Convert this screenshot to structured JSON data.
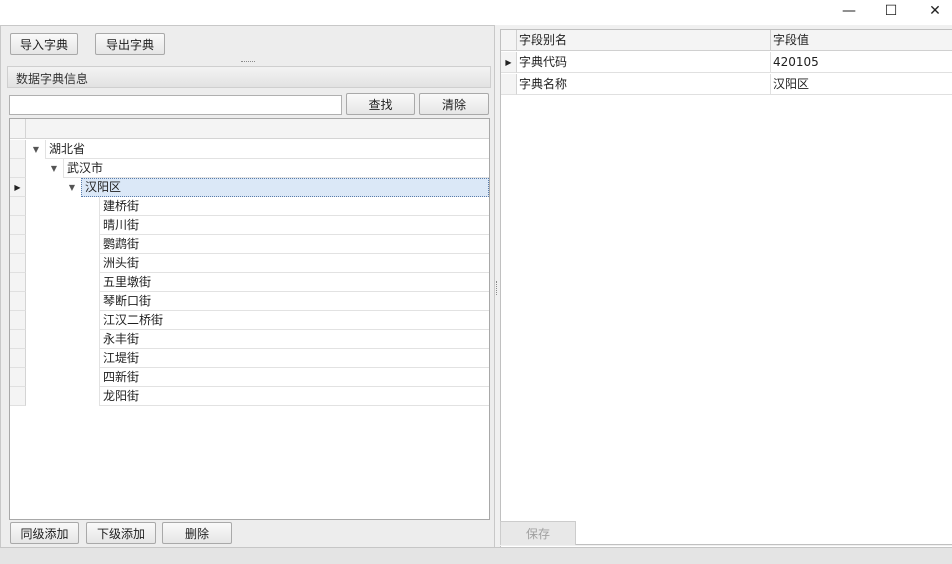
{
  "window": {
    "controls": {
      "minimize": "—",
      "maximize": "☐",
      "close": "✕"
    }
  },
  "toolbar": {
    "import_label": "导入字典",
    "export_label": "导出字典"
  },
  "dictionary_panel": {
    "title": "数据字典信息",
    "search": {
      "value": "",
      "placeholder": ""
    },
    "find_label": "查找",
    "clear_label": "清除"
  },
  "tree": {
    "rows": [
      {
        "label": "湖北省",
        "level": 0,
        "expanded": true,
        "selected": false
      },
      {
        "label": "武汉市",
        "level": 1,
        "expanded": true,
        "selected": false
      },
      {
        "label": "汉阳区",
        "level": 2,
        "expanded": true,
        "selected": true
      },
      {
        "label": "建桥街",
        "level": 3,
        "expanded": false,
        "selected": false
      },
      {
        "label": "晴川街",
        "level": 3,
        "expanded": false,
        "selected": false
      },
      {
        "label": "鹦鹉街",
        "level": 3,
        "expanded": false,
        "selected": false
      },
      {
        "label": "洲头街",
        "level": 3,
        "expanded": false,
        "selected": false
      },
      {
        "label": "五里墩街",
        "level": 3,
        "expanded": false,
        "selected": false
      },
      {
        "label": "琴断口街",
        "level": 3,
        "expanded": false,
        "selected": false
      },
      {
        "label": "江汉二桥街",
        "level": 3,
        "expanded": false,
        "selected": false
      },
      {
        "label": "永丰街",
        "level": 3,
        "expanded": false,
        "selected": false
      },
      {
        "label": "江堤街",
        "level": 3,
        "expanded": false,
        "selected": false
      },
      {
        "label": "四新街",
        "level": 3,
        "expanded": false,
        "selected": false
      },
      {
        "label": "龙阳街",
        "level": 3,
        "expanded": false,
        "selected": false
      }
    ]
  },
  "bottom_actions": {
    "add_sibling_label": "同级添加",
    "add_child_label": "下级添加",
    "delete_label": "删除"
  },
  "property_grid": {
    "columns": [
      "字段别名",
      "字段值"
    ],
    "rows": [
      {
        "alias": "字典代码",
        "value": "420105",
        "current": true
      },
      {
        "alias": "字典名称",
        "value": "汉阳区",
        "current": false
      }
    ]
  },
  "save_label": "保存"
}
